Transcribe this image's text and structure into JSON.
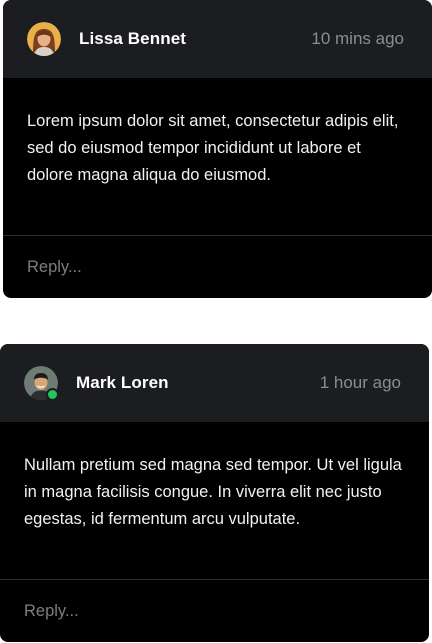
{
  "comments": [
    {
      "author": "Lissa Bennet",
      "time": "10 mins ago",
      "avatar_icon": "woman-avatar",
      "online": false,
      "body": "Lorem ipsum dolor sit amet, consectetur adipis elit, sed do eiusmod tempor incididunt ut labore et dolore magna aliqua do eiusmod.",
      "reply_placeholder": "Reply..."
    },
    {
      "author": "Mark Loren",
      "time": "1 hour ago",
      "avatar_icon": "man-avatar",
      "online": true,
      "body": "Nullam pretium sed magna sed tempor. Ut vel ligula in magna facilisis congue. In viverra elit nec justo egestas, id fermentum arcu vulputate.",
      "reply_placeholder": "Reply..."
    }
  ],
  "colors": {
    "card_bg": "#000000",
    "header_bg": "#1c1d20",
    "muted_text": "#8c8d90",
    "online_status": "#22c55e"
  }
}
